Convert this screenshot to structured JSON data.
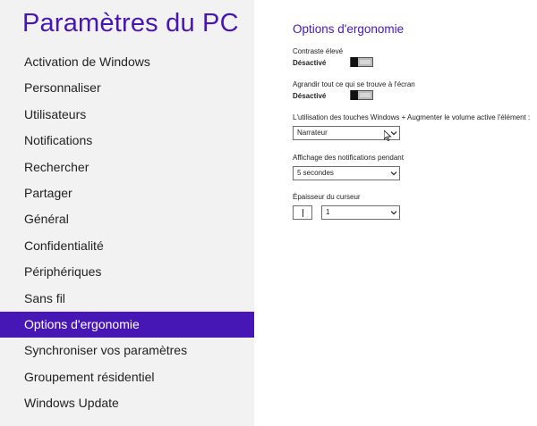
{
  "sidebar": {
    "title": "Paramètres du PC",
    "items": [
      {
        "label": "Activation de Windows"
      },
      {
        "label": "Personnaliser"
      },
      {
        "label": "Utilisateurs"
      },
      {
        "label": "Notifications"
      },
      {
        "label": "Rechercher"
      },
      {
        "label": "Partager"
      },
      {
        "label": "Général"
      },
      {
        "label": "Confidentialité"
      },
      {
        "label": "Périphériques"
      },
      {
        "label": "Sans fil"
      },
      {
        "label": "Options d'ergonomie"
      },
      {
        "label": "Synchroniser vos paramètres"
      },
      {
        "label": "Groupement résidentiel"
      },
      {
        "label": "Windows Update"
      }
    ],
    "active_index": 10
  },
  "main": {
    "title": "Options d'ergonomie",
    "high_contrast": {
      "label": "Contraste élevé",
      "value": "Désactivé",
      "on": false
    },
    "enlarge": {
      "label": "Agrandir tout ce qui se trouve à l'écran",
      "value": "Désactivé",
      "on": false
    },
    "win_volume": {
      "label": "L'utilisation des touches Windows + Augmenter le volume active l'élément :",
      "selected": "Narrateur"
    },
    "notif_duration": {
      "label": "Affichage des notifications pendant",
      "selected": "5 secondes"
    },
    "cursor_thickness": {
      "label": "Épaisseur du curseur",
      "selected": "1"
    }
  },
  "colors": {
    "accent": "#4617b4",
    "sidebar_bg": "#f2f2f2",
    "text": "#222222"
  }
}
